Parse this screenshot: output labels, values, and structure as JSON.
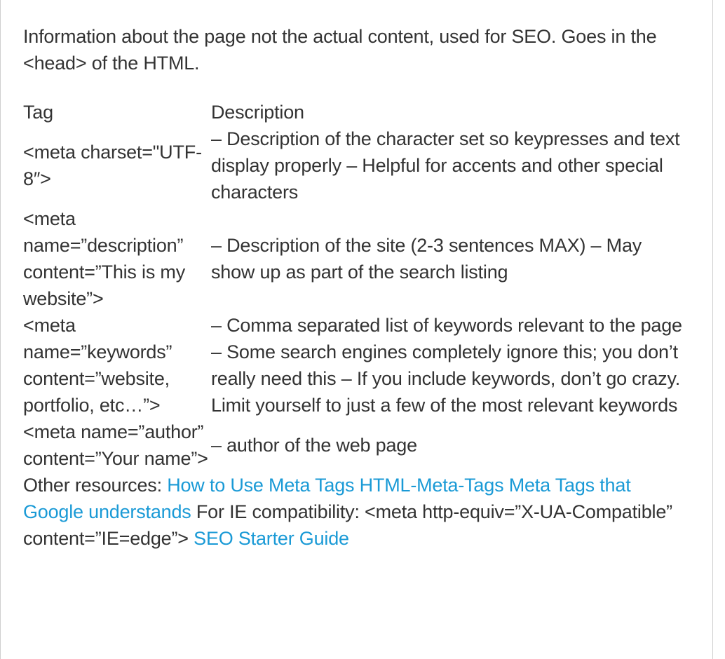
{
  "intro": "Information about the page not the actual content, used for SEO. Goes in the <head> of the HTML.",
  "table": {
    "headers": {
      "tag": "Tag",
      "description": "Description"
    },
    "rows": [
      {
        "tag": "<meta charset=\"UTF-8″>",
        "description": "– Description of the character set so keypresses and text display properly – Helpful for accents and other special characters"
      },
      {
        "tag": "<meta name=”description” content=”This is my website”>",
        "description": "– Description of the site (2-3 sentences MAX) – May show up as part of the search listing"
      },
      {
        "tag": "<meta name=”keywords” content=”website, portfolio, etc…”>",
        "description": "– Comma separated list of keywords relevant to the page – Some search engines completely ignore this; you don’t really need this – If you include keywords, don’t go crazy. Limit yourself to just a few of the most relevant keywords"
      },
      {
        "tag": "<meta name=”author” content=”Your name”>",
        "description": "– author of the web page"
      }
    ]
  },
  "resources": {
    "label": "Other resources: ",
    "link1": "How to Use Meta Tags",
    "link2": "HTML-Meta-Tags",
    "link3": "Meta Tags that Google understands",
    "ie_text": " For IE compatibility: <meta http-equiv=”X-UA-Compatible” content=”IE=edge”> ",
    "link4": "SEO Starter Guide",
    "link_color": "#1a9ad6"
  }
}
